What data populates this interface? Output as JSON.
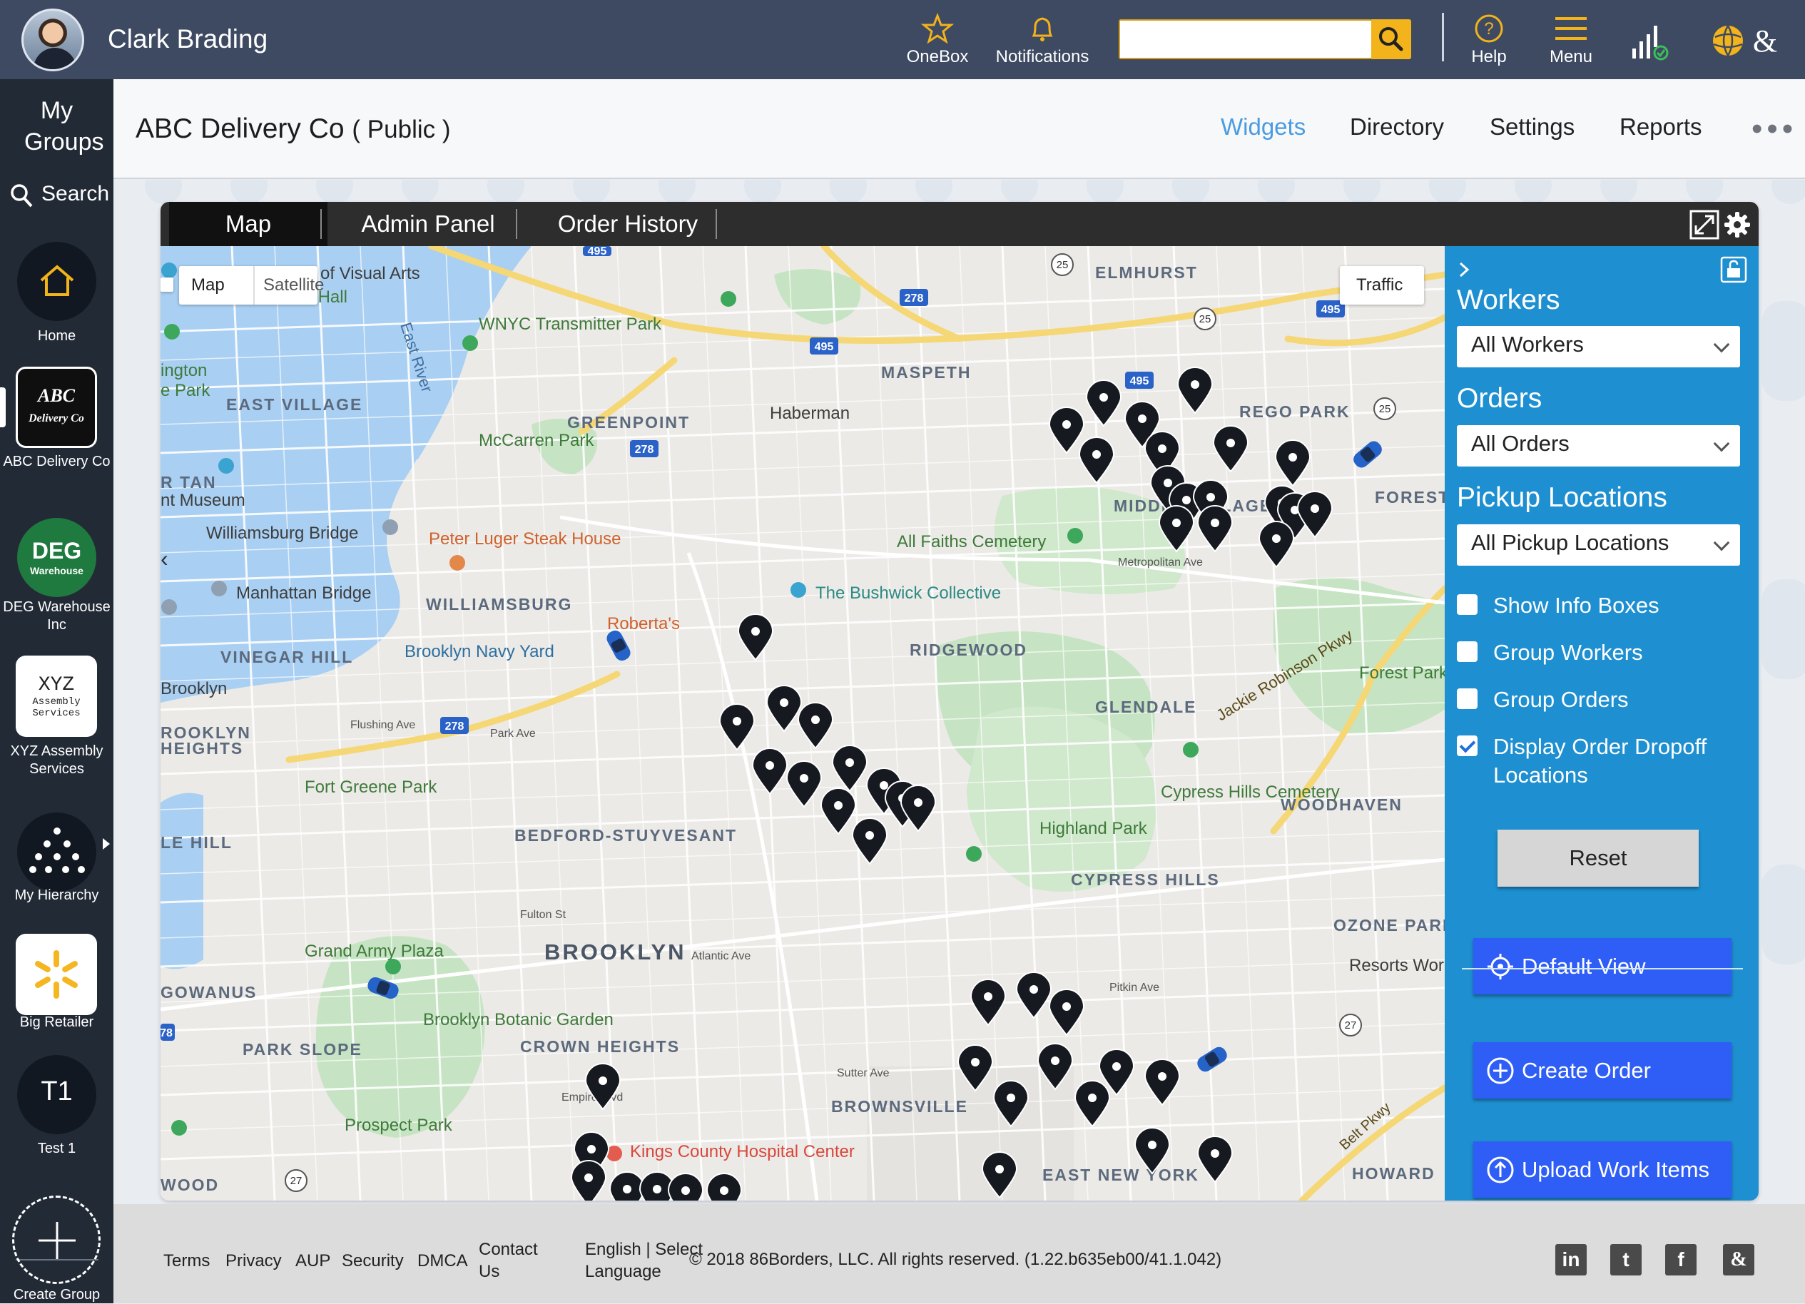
{
  "topbar": {
    "user_name": "Clark Brading",
    "onebox_label": "OneBox",
    "notifications_label": "Notifications",
    "search_placeholder": "",
    "help_label": "Help",
    "menu_label": "Menu",
    "accent_color": "#f2b31b"
  },
  "rail": {
    "my_groups": "My Groups",
    "search": "Search",
    "home": "Home",
    "groups": [
      {
        "logo": "ABC Delivery Co",
        "label": "ABC Delivery Co"
      },
      {
        "logo": "DEG",
        "logo_sub": "Warehouse",
        "label": "DEG Warehouse Inc"
      },
      {
        "logo": "XYZ",
        "logo_sub": "Assembly Services",
        "label": "XYZ Assembly Services"
      },
      {
        "label": "My Hierarchy"
      },
      {
        "label": "Big Retailer"
      },
      {
        "logo": "T1",
        "label": "Test 1"
      }
    ],
    "create_group": "Create Group"
  },
  "header": {
    "org_name": "ABC Delivery Co",
    "org_visibility": "( Public )",
    "nav": {
      "widgets": "Widgets",
      "directory": "Directory",
      "settings": "Settings",
      "reports": "Reports"
    },
    "more": "•••"
  },
  "panel": {
    "tabs": {
      "map": "Map",
      "admin": "Admin Panel",
      "history": "Order History"
    },
    "map_type": {
      "map": "Map",
      "satellite": "Satellite"
    },
    "traffic": "Traffic",
    "map_labels": {
      "l1": "ELMHURST",
      "l2": "MASPETH",
      "l3": "REGO PARK",
      "l4": "Haberman",
      "l5": "GREENPOINT",
      "l6": "McCarren Park",
      "l7": "EAST VILLAGE",
      "l8": "WNYC Transmitter Park",
      "l9": "Webster Hall",
      "l10": "Williamsburg Bridge",
      "l11": "Peter Luger Steak House",
      "l12": "WILLIAMSBURG",
      "l13": "Manhattan Bridge",
      "l14": "VINEGAR HILL",
      "l15": "Brooklyn Navy Yard",
      "l16": "Roberta's",
      "l17": "The Bushwick Collective",
      "l18": "RIDGEWOOD",
      "l19": "All Faiths Cemetery",
      "l20": "GLENDALE",
      "l21": "Cypress Hills Cemetery",
      "l22": "WOODHAVEN",
      "l23": "Highland Park",
      "l24": "CYPRESS HILLS",
      "l25": "BEDFORD-STUYVESANT",
      "l26": "Fort Greene Park",
      "l27": "BROOKLYN",
      "l28": "Grand Army Plaza",
      "l29": "GOWANUS",
      "l30": "PARK SLOPE",
      "l31": "Brooklyn Botanic Garden",
      "l32": "CROWN HEIGHTS",
      "l33": "Prospect Park",
      "l34": "Kings County Hospital Center",
      "l35": "BROWNSVILLE",
      "l36": "EAST NEW YORK",
      "l37": "OZONE PARK",
      "l38": "Forest Park",
      "l39": "Jackie Robinson Pkwy",
      "l40": "MIDDLE VILLAGE",
      "l41": "Metropolitan Ave",
      "l42": "Flushing Ave",
      "l43": "Park Ave",
      "l44": "Atlantic Ave",
      "l45": "Fulton St",
      "l46": "Empire Blvd",
      "l47": "Pitkin Ave",
      "l48": "Sutter Ave",
      "l49": "Belt Pkwy",
      "l50": "HOWARD",
      "l51": "Resorts World New",
      "l52": "FOREST",
      "l53": "HEIGHTS",
      "l54": "Brooklyn",
      "l55": "e Park",
      "l56": "of Visual Arts",
      "l57": "East River",
      "l58": "nt Museum",
      "l59": "ington",
      "l60": "R TAN",
      "l61": "LE HILL",
      "l62": "WOOD",
      "l63": "ROOKLYN"
    }
  },
  "sidebar": {
    "workers_heading": "Workers",
    "workers_value": "All Workers",
    "orders_heading": "Orders",
    "orders_value": "All Orders",
    "pickup_heading": "Pickup Locations",
    "pickup_value": "All Pickup Locations",
    "checks": [
      {
        "label": "Show Info Boxes",
        "checked": false
      },
      {
        "label": "Group Workers",
        "checked": false
      },
      {
        "label": "Group Orders",
        "checked": false
      },
      {
        "label": "Display Order Dropoff Locations",
        "checked": true
      }
    ],
    "reset": "Reset",
    "default_view": "Default View",
    "create_order": "Create Order",
    "upload": "Upload Work Items",
    "panel_color": "#1e8fd0",
    "button_color": "#2f5ef6"
  },
  "footer": {
    "links": [
      "Terms",
      "Privacy",
      "AUP",
      "Security",
      "DMCA"
    ],
    "contact": "Contact Us",
    "language": "English | Select Language",
    "copyright": "© 2018 86Borders, LLC. All rights reserved. (1.22.b635eb00/41.1.042)"
  }
}
